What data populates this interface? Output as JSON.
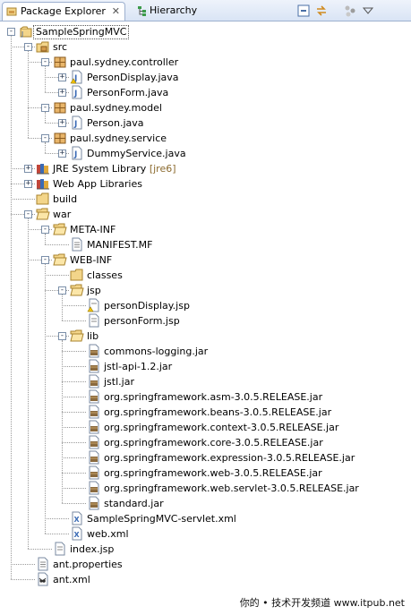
{
  "tabs": [
    {
      "label": "Package Explorer",
      "icon": "package-explorer-icon",
      "active": true,
      "close": "✕"
    },
    {
      "label": "Hierarchy",
      "icon": "hierarchy-icon",
      "active": false
    }
  ],
  "toolbar": [
    "collapse-all-icon",
    "link-with-editor-icon",
    "filters-icon",
    "view-menu-icon"
  ],
  "tree": [
    {
      "label": "SampleSpringMVC",
      "icon": "project",
      "depth": 0,
      "toggle": "-",
      "selected": true
    },
    {
      "label": "src",
      "icon": "source-folder",
      "depth": 1,
      "toggle": "-"
    },
    {
      "label": "paul.sydney.controller",
      "icon": "package",
      "depth": 2,
      "toggle": "-"
    },
    {
      "label": "PersonDisplay.java",
      "icon": "java-file-warn",
      "depth": 3,
      "toggle": "+"
    },
    {
      "label": "PersonForm.java",
      "icon": "java-file",
      "depth": 3,
      "toggle": "+"
    },
    {
      "label": "paul.sydney.model",
      "icon": "package",
      "depth": 2,
      "toggle": "-"
    },
    {
      "label": "Person.java",
      "icon": "java-file",
      "depth": 3,
      "toggle": "+"
    },
    {
      "label": "paul.sydney.service",
      "icon": "package",
      "depth": 2,
      "toggle": "-"
    },
    {
      "label": "DummyService.java",
      "icon": "java-file",
      "depth": 3,
      "toggle": "+"
    },
    {
      "label": "JRE System Library",
      "decoration": "[jre6]",
      "icon": "library",
      "depth": 1,
      "toggle": "+"
    },
    {
      "label": "Web App Libraries",
      "icon": "library",
      "depth": 1,
      "toggle": "+"
    },
    {
      "label": "build",
      "icon": "folder",
      "depth": 1,
      "toggle": ""
    },
    {
      "label": "war",
      "icon": "folder-open",
      "depth": 1,
      "toggle": "-"
    },
    {
      "label": "META-INF",
      "icon": "folder-open",
      "depth": 2,
      "toggle": "-"
    },
    {
      "label": "MANIFEST.MF",
      "icon": "text-file",
      "depth": 3,
      "toggle": ""
    },
    {
      "label": "WEB-INF",
      "icon": "folder-open",
      "depth": 2,
      "toggle": "-"
    },
    {
      "label": "classes",
      "icon": "folder",
      "depth": 3,
      "toggle": ""
    },
    {
      "label": "jsp",
      "icon": "folder-open",
      "depth": 3,
      "toggle": "-"
    },
    {
      "label": "personDisplay.jsp",
      "icon": "jsp-file-warn",
      "depth": 4,
      "toggle": ""
    },
    {
      "label": "personForm.jsp",
      "icon": "jsp-file",
      "depth": 4,
      "toggle": ""
    },
    {
      "label": "lib",
      "icon": "folder-open",
      "depth": 3,
      "toggle": "-"
    },
    {
      "label": "commons-logging.jar",
      "icon": "jar-file",
      "depth": 4,
      "toggle": ""
    },
    {
      "label": "jstl-api-1.2.jar",
      "icon": "jar-file",
      "depth": 4,
      "toggle": ""
    },
    {
      "label": "jstl.jar",
      "icon": "jar-file",
      "depth": 4,
      "toggle": ""
    },
    {
      "label": "org.springframework.asm-3.0.5.RELEASE.jar",
      "icon": "jar-file",
      "depth": 4,
      "toggle": ""
    },
    {
      "label": "org.springframework.beans-3.0.5.RELEASE.jar",
      "icon": "jar-file",
      "depth": 4,
      "toggle": ""
    },
    {
      "label": "org.springframework.context-3.0.5.RELEASE.jar",
      "icon": "jar-file",
      "depth": 4,
      "toggle": ""
    },
    {
      "label": "org.springframework.core-3.0.5.RELEASE.jar",
      "icon": "jar-file",
      "depth": 4,
      "toggle": ""
    },
    {
      "label": "org.springframework.expression-3.0.5.RELEASE.jar",
      "icon": "jar-file",
      "depth": 4,
      "toggle": ""
    },
    {
      "label": "org.springframework.web-3.0.5.RELEASE.jar",
      "icon": "jar-file",
      "depth": 4,
      "toggle": ""
    },
    {
      "label": "org.springframework.web.servlet-3.0.5.RELEASE.jar",
      "icon": "jar-file",
      "depth": 4,
      "toggle": ""
    },
    {
      "label": "standard.jar",
      "icon": "jar-file",
      "depth": 4,
      "toggle": ""
    },
    {
      "label": "SampleSpringMVC-servlet.xml",
      "icon": "xml-file",
      "depth": 3,
      "toggle": ""
    },
    {
      "label": "web.xml",
      "icon": "xml-file",
      "depth": 3,
      "toggle": ""
    },
    {
      "label": "index.jsp",
      "icon": "jsp-file",
      "depth": 2,
      "toggle": ""
    },
    {
      "label": "ant.properties",
      "icon": "text-file",
      "depth": 1,
      "toggle": ""
    },
    {
      "label": "ant.xml",
      "icon": "ant-file",
      "depth": 1,
      "toggle": ""
    }
  ],
  "watermark": "你的 • 技术开发频道  www.itpub.net",
  "colors": {
    "tab_bar": "#d9e4f5",
    "tab_border": "#9db0cf",
    "folder": "#f3d58a",
    "package": "#d29b4a",
    "java": "#3b6bb5",
    "decoration": "#8b6a2e"
  }
}
